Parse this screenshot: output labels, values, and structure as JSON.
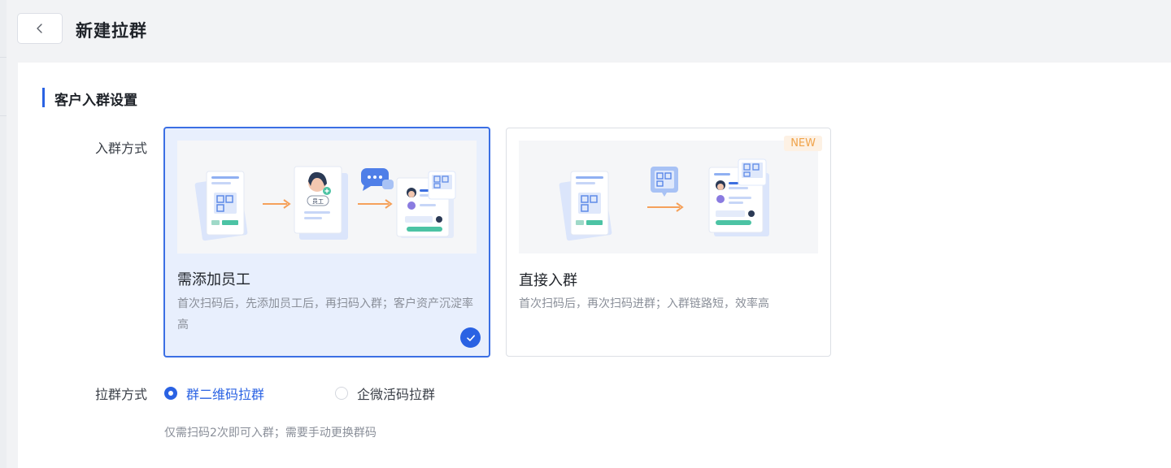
{
  "header": {
    "title": "新建拉群"
  },
  "section": {
    "title": "客户入群设置"
  },
  "join_method": {
    "label": "入群方式",
    "options": [
      {
        "title": "需添加员工",
        "desc": "首次扫码后，先添加员工后，再扫码入群；客户资产沉淀率高",
        "selected": true,
        "illus_tag": "员工"
      },
      {
        "title": "直接入群",
        "desc": "首次扫码后，再次扫码进群；入群链路短，效率高",
        "selected": false,
        "badge": "NEW"
      }
    ]
  },
  "pull_method": {
    "label": "拉群方式",
    "options": [
      {
        "label": "群二维码拉群",
        "selected": true
      },
      {
        "label": "企微活码拉群",
        "selected": false
      }
    ],
    "hint": "仅需扫码2次即可入群；需要手动更换群码"
  },
  "colors": {
    "accent": "#2a62e3",
    "selected_card_bg": "#e8effd",
    "badge_text": "#f0a34a",
    "badge_bg": "#fdf1e4"
  }
}
